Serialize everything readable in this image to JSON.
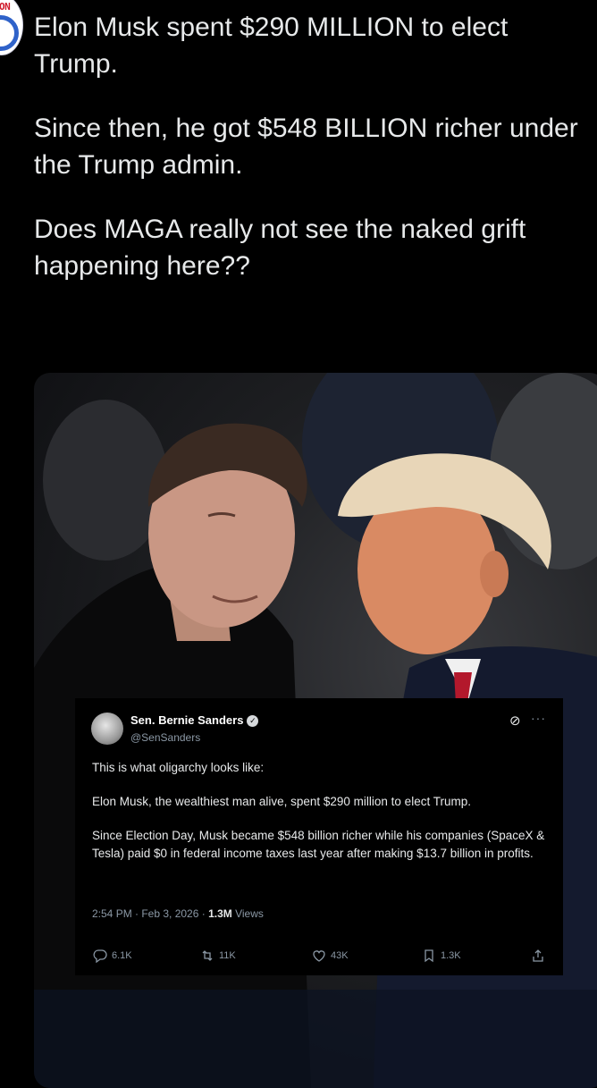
{
  "tweet": {
    "paragraphs": [
      "Elon Musk spent $290 MILLION to elect Trump.",
      "Since then, he got $548 BILLION richer under the Trump admin.",
      "Does MAGA really not see the naked grift happening here??"
    ]
  },
  "avatar": {
    "tag": "ON"
  },
  "embed": {
    "name": "Sen. Bernie Sanders",
    "handle": "@SenSanders",
    "body": [
      "This is what oligarchy looks like:",
      "Elon Musk, the wealthiest man alive, spent $290 million to elect Trump.",
      "Since Election Day, Musk became $548 billion richer while his companies (SpaceX & Tesla) paid $0 in federal income taxes last year after making $13.7 billion in profits."
    ],
    "time": "2:54 PM · Feb 3, 2026 · ",
    "views_count": "1.3M",
    "views_label": " Views",
    "actions": {
      "replies": "6.1K",
      "reposts": "11K",
      "likes": "43K",
      "bookmarks": "1.3K"
    }
  },
  "colors": {
    "background": "#000000",
    "text": "#e7e9ea",
    "muted": "#8b98a5"
  }
}
